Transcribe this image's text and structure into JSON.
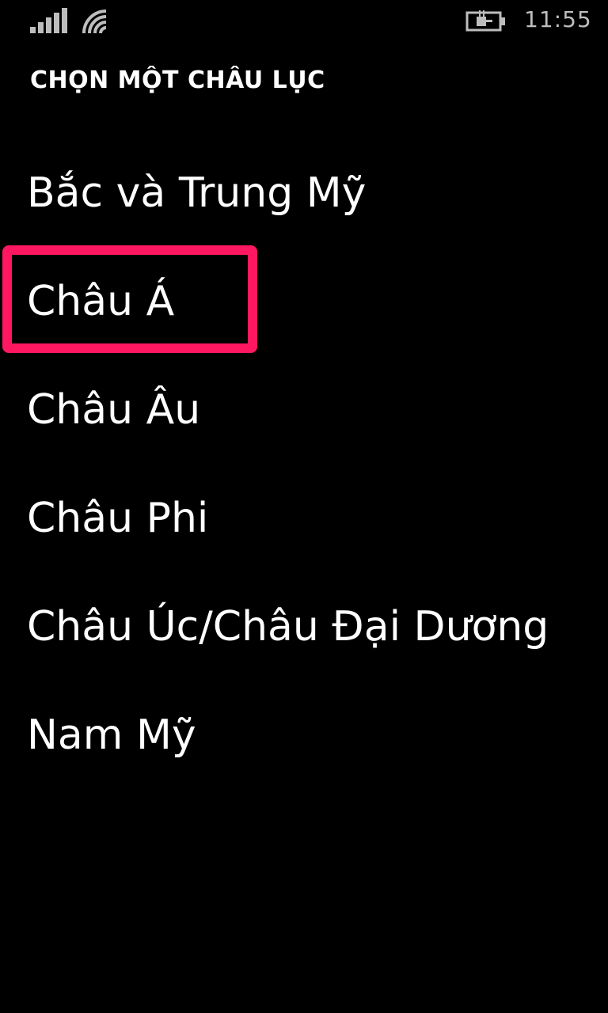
{
  "status_bar": {
    "signal_icon": "signal-strength-icon",
    "wifi_icon": "wifi-icon",
    "battery_icon": "battery-charging-icon",
    "time": "11:55"
  },
  "header": {
    "title": "CHỌN MỘT CHÂU LỤC"
  },
  "continents": [
    {
      "label": "Bắc và Trung Mỹ"
    },
    {
      "label": "Châu Á",
      "highlighted": true
    },
    {
      "label": "Châu Âu"
    },
    {
      "label": "Châu Phi"
    },
    {
      "label": "Châu Úc/Châu Đại Dương"
    },
    {
      "label": "Nam Mỹ"
    }
  ],
  "colors": {
    "background": "#000000",
    "text": "#ffffff",
    "status_text": "#bdbdbd",
    "highlight": "#ff1861"
  }
}
